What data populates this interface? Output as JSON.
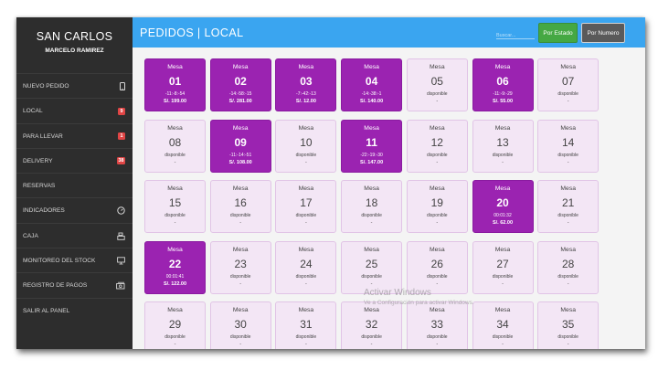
{
  "sidebar": {
    "brand": "SAN CARLOS",
    "user": "MARCELO RAMIREZ",
    "items": [
      {
        "label": "NUEVO PEDIDO",
        "icon": "mobile-icon",
        "badge": ""
      },
      {
        "label": "LOCAL",
        "icon": "",
        "badge": "9"
      },
      {
        "label": "PARA LLEVAR",
        "icon": "",
        "badge": "1"
      },
      {
        "label": "DELIVERY",
        "icon": "",
        "badge": "38"
      },
      {
        "label": "RESERVAS",
        "icon": "",
        "badge": ""
      },
      {
        "label": "INDICADORES",
        "icon": "dashboard-icon",
        "badge": ""
      },
      {
        "label": "CAJA",
        "icon": "cash-register-icon",
        "badge": ""
      },
      {
        "label": "MONITOREO DEL STOCK",
        "icon": "monitor-icon",
        "badge": ""
      },
      {
        "label": "REGISTRO DE PAGOS",
        "icon": "money-icon",
        "badge": ""
      },
      {
        "label": "SALIR AL PANEL",
        "icon": "",
        "badge": ""
      }
    ]
  },
  "header": {
    "title": "PEDIDOS | LOCAL",
    "search_placeholder": "Buscar...",
    "btn_estado": "Por Estado",
    "btn_numero": "Por Numero"
  },
  "colors": {
    "topbar": "#3aa5f0",
    "busy": "#9b23b1",
    "free": "#f3e6f5",
    "estado": "#45a843",
    "badge": "#e04545"
  },
  "tables": [
    {
      "label": "Mesa",
      "num": "01",
      "busy": true,
      "line1": "-11:-8:-54",
      "line2": "S/. 199.00"
    },
    {
      "label": "Mesa",
      "num": "02",
      "busy": true,
      "line1": "-14:-58:-15",
      "line2": "S/. 281.00"
    },
    {
      "label": "Mesa",
      "num": "03",
      "busy": true,
      "line1": "-7:-42:-13",
      "line2": "S/. 12.00"
    },
    {
      "label": "Mesa",
      "num": "04",
      "busy": true,
      "line1": "-14:-38:-1",
      "line2": "S/. 140.00"
    },
    {
      "label": "Mesa",
      "num": "05",
      "busy": false,
      "line1": "disponible",
      "line2": "-"
    },
    {
      "label": "Mesa",
      "num": "06",
      "busy": true,
      "line1": "-11:-9:-29",
      "line2": "S/. 55.00"
    },
    {
      "label": "Mesa",
      "num": "07",
      "busy": false,
      "line1": "disponible",
      "line2": "-"
    },
    {
      "label": "Mesa",
      "num": "08",
      "busy": false,
      "line1": "disponible",
      "line2": "-"
    },
    {
      "label": "Mesa",
      "num": "09",
      "busy": true,
      "line1": "-11:-14:-51",
      "line2": "S/. 108.00"
    },
    {
      "label": "Mesa",
      "num": "10",
      "busy": false,
      "line1": "disponible",
      "line2": "-"
    },
    {
      "label": "Mesa",
      "num": "11",
      "busy": true,
      "line1": "-22:-19:-30",
      "line2": "S/. 147.00"
    },
    {
      "label": "Mesa",
      "num": "12",
      "busy": false,
      "line1": "disponible",
      "line2": "-"
    },
    {
      "label": "Mesa",
      "num": "13",
      "busy": false,
      "line1": "disponible",
      "line2": "-"
    },
    {
      "label": "Mesa",
      "num": "14",
      "busy": false,
      "line1": "disponible",
      "line2": "-"
    },
    {
      "label": "Mesa",
      "num": "15",
      "busy": false,
      "line1": "disponible",
      "line2": "-"
    },
    {
      "label": "Mesa",
      "num": "16",
      "busy": false,
      "line1": "disponible",
      "line2": "-"
    },
    {
      "label": "Mesa",
      "num": "17",
      "busy": false,
      "line1": "disponible",
      "line2": "-"
    },
    {
      "label": "Mesa",
      "num": "18",
      "busy": false,
      "line1": "disponible",
      "line2": "-"
    },
    {
      "label": "Mesa",
      "num": "19",
      "busy": false,
      "line1": "disponible",
      "line2": "-"
    },
    {
      "label": "Mesa",
      "num": "20",
      "busy": true,
      "line1": "00:01:32",
      "line2": "S/. 62.00"
    },
    {
      "label": "Mesa",
      "num": "21",
      "busy": false,
      "line1": "disponible",
      "line2": "-"
    },
    {
      "label": "Mesa",
      "num": "22",
      "busy": true,
      "line1": "00:01:41",
      "line2": "S/. 122.00"
    },
    {
      "label": "Mesa",
      "num": "23",
      "busy": false,
      "line1": "disponible",
      "line2": "-"
    },
    {
      "label": "Mesa",
      "num": "24",
      "busy": false,
      "line1": "disponible",
      "line2": "-"
    },
    {
      "label": "Mesa",
      "num": "25",
      "busy": false,
      "line1": "disponible",
      "line2": "-"
    },
    {
      "label": "Mesa",
      "num": "26",
      "busy": false,
      "line1": "disponible",
      "line2": "-"
    },
    {
      "label": "Mesa",
      "num": "27",
      "busy": false,
      "line1": "disponible",
      "line2": "-"
    },
    {
      "label": "Mesa",
      "num": "28",
      "busy": false,
      "line1": "disponible",
      "line2": "-"
    },
    {
      "label": "Mesa",
      "num": "29",
      "busy": false,
      "line1": "disponible",
      "line2": "-"
    },
    {
      "label": "Mesa",
      "num": "30",
      "busy": false,
      "line1": "disponible",
      "line2": "-"
    },
    {
      "label": "Mesa",
      "num": "31",
      "busy": false,
      "line1": "disponible",
      "line2": "-"
    },
    {
      "label": "Mesa",
      "num": "32",
      "busy": false,
      "line1": "disponible",
      "line2": "-"
    },
    {
      "label": "Mesa",
      "num": "33",
      "busy": false,
      "line1": "disponible",
      "line2": "-"
    },
    {
      "label": "Mesa",
      "num": "34",
      "busy": false,
      "line1": "disponible",
      "line2": "-"
    },
    {
      "label": "Mesa",
      "num": "35",
      "busy": false,
      "line1": "disponible",
      "line2": "-"
    }
  ],
  "watermark": {
    "line1": "Activar Windows",
    "line2": "Ve a Configuración para activar Windows."
  }
}
